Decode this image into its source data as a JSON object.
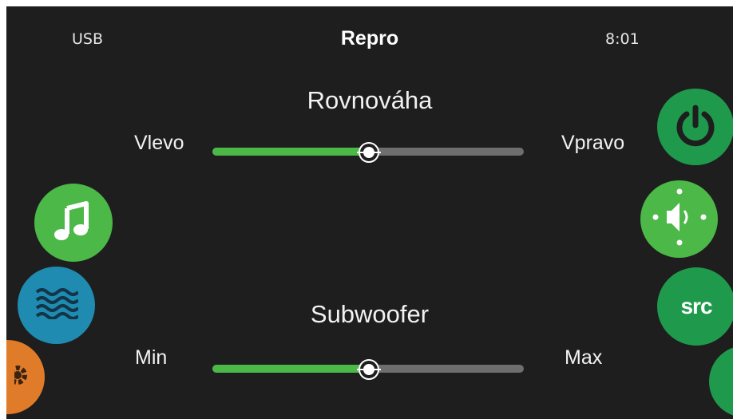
{
  "header": {
    "source": "USB",
    "title": "Repro",
    "time": "8:01"
  },
  "balance": {
    "title": "Rovnováha",
    "left_label": "Vlevo",
    "right_label": "Vpravo",
    "level": 0.5
  },
  "subwoofer": {
    "title": "Subwoofer",
    "left_label": "Min",
    "right_label": "Max",
    "level": 0.5
  },
  "left_nav": [
    {
      "icon": "music-note-icon",
      "color": "#4cb848"
    },
    {
      "icon": "waves-icon",
      "color": "#1f8bb0"
    },
    {
      "icon": "gear-icon",
      "color": "#e07b2a"
    }
  ],
  "right_nav": [
    {
      "icon": "power-icon",
      "color": "#1f9a4d"
    },
    {
      "icon": "speaker-balance-icon",
      "color": "#4cb848"
    },
    {
      "icon": "src-icon",
      "label": "src",
      "color": "#1f9a4d"
    },
    {
      "icon": "chevron-down-icon",
      "color": "#1f9a4d"
    }
  ],
  "colors": {
    "background": "#1e1e1e",
    "slider_fill": "#4cb848",
    "slider_track": "#6e6e6e"
  }
}
